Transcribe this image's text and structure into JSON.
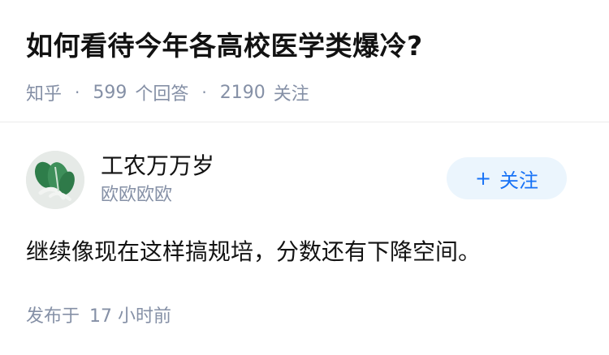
{
  "question": {
    "title": "如何看待今年各高校医学类爆冷?",
    "source": "知乎",
    "answer_count": "599",
    "answer_label": "个回答",
    "follower_count": "2190",
    "follower_label": "关注"
  },
  "answer": {
    "author": {
      "name": "工农万万岁",
      "bio": "欧欧欧欧",
      "avatar_icon": "cabbage-icon"
    },
    "follow_button": {
      "plus": "+",
      "label": "关注"
    },
    "content": "继续像现在这样搞规培，分数还有下降空间。",
    "published_label": "发布于",
    "published_time": "17 小时前"
  },
  "colors": {
    "text_primary": "#121212",
    "text_secondary": "#8590a6",
    "accent": "#1772f6",
    "accent_bg": "#ebf5fd"
  }
}
